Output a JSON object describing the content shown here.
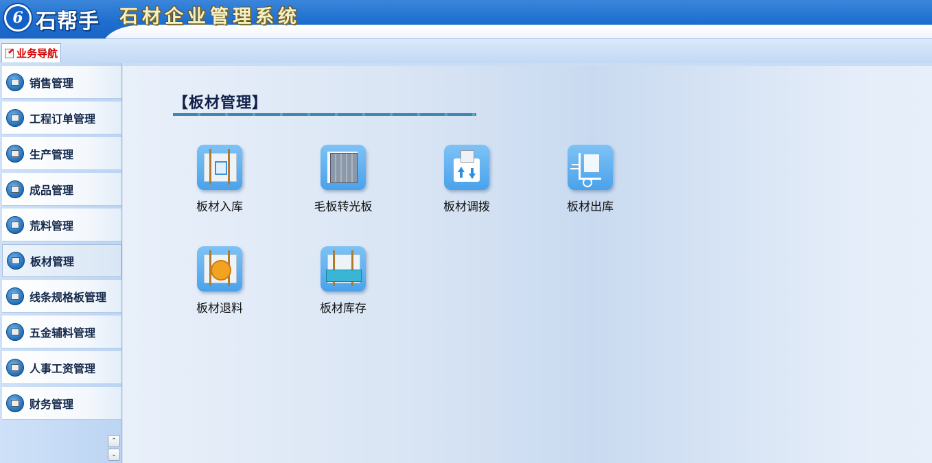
{
  "header": {
    "logo_glyph": "6",
    "brand_name": "石帮手",
    "system_title": "石材企业管理系统"
  },
  "tabbar": {
    "tab_label": "业务导航"
  },
  "sidebar": {
    "items": [
      {
        "label": "销售管理",
        "icon": "sales-icon"
      },
      {
        "label": "工程订单管理",
        "icon": "project-order-icon"
      },
      {
        "label": "生产管理",
        "icon": "production-icon"
      },
      {
        "label": "成品管理",
        "icon": "finished-goods-icon"
      },
      {
        "label": "荒料管理",
        "icon": "raw-block-icon"
      },
      {
        "label": "板材管理",
        "icon": "slab-icon",
        "active": true
      },
      {
        "label": "线条规格板管理",
        "icon": "profile-board-icon"
      },
      {
        "label": "五金辅料管理",
        "icon": "hardware-icon"
      },
      {
        "label": "人事工资管理",
        "icon": "hr-payroll-icon"
      },
      {
        "label": "财务管理",
        "icon": "finance-icon"
      }
    ],
    "scroll_up_glyph": "⌃",
    "scroll_down_glyph": "⌄"
  },
  "main": {
    "section_title": "【板材管理】",
    "tiles": [
      {
        "label": "板材入库",
        "icon": "slab-inbound-icon"
      },
      {
        "label": "毛板转光板",
        "icon": "rough-to-polished-icon"
      },
      {
        "label": "板材调拨",
        "icon": "slab-transfer-icon"
      },
      {
        "label": "板材出库",
        "icon": "slab-outbound-icon"
      },
      {
        "label": "板材退料",
        "icon": "slab-return-icon"
      },
      {
        "label": "板材库存",
        "icon": "slab-inventory-icon"
      }
    ]
  },
  "colors": {
    "header_blue": "#1f6fd0",
    "tab_label_red": "#d40000",
    "tile_blue": "#4aa2ea"
  }
}
